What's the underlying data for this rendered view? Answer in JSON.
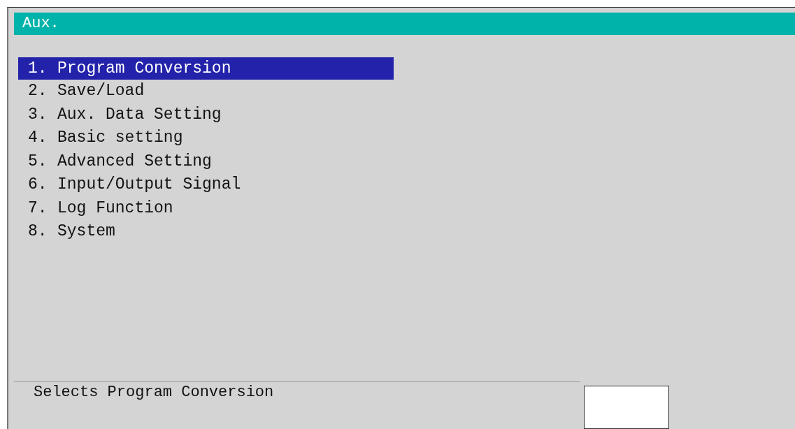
{
  "window": {
    "title": "Aux."
  },
  "menu": [
    {
      "number": "1.",
      "label": "Program Conversion",
      "selected": true
    },
    {
      "number": "2.",
      "label": "Save/Load",
      "selected": false
    },
    {
      "number": "3.",
      "label": "Aux. Data Setting",
      "selected": false
    },
    {
      "number": "4.",
      "label": "Basic setting",
      "selected": false
    },
    {
      "number": "5.",
      "label": "Advanced Setting",
      "selected": false
    },
    {
      "number": "6.",
      "label": "Input/Output Signal",
      "selected": false
    },
    {
      "number": "7.",
      "label": "Log Function",
      "selected": false
    },
    {
      "number": "8.",
      "label": "System",
      "selected": false
    }
  ],
  "status_bar": {
    "message": "Selects Program Conversion"
  }
}
